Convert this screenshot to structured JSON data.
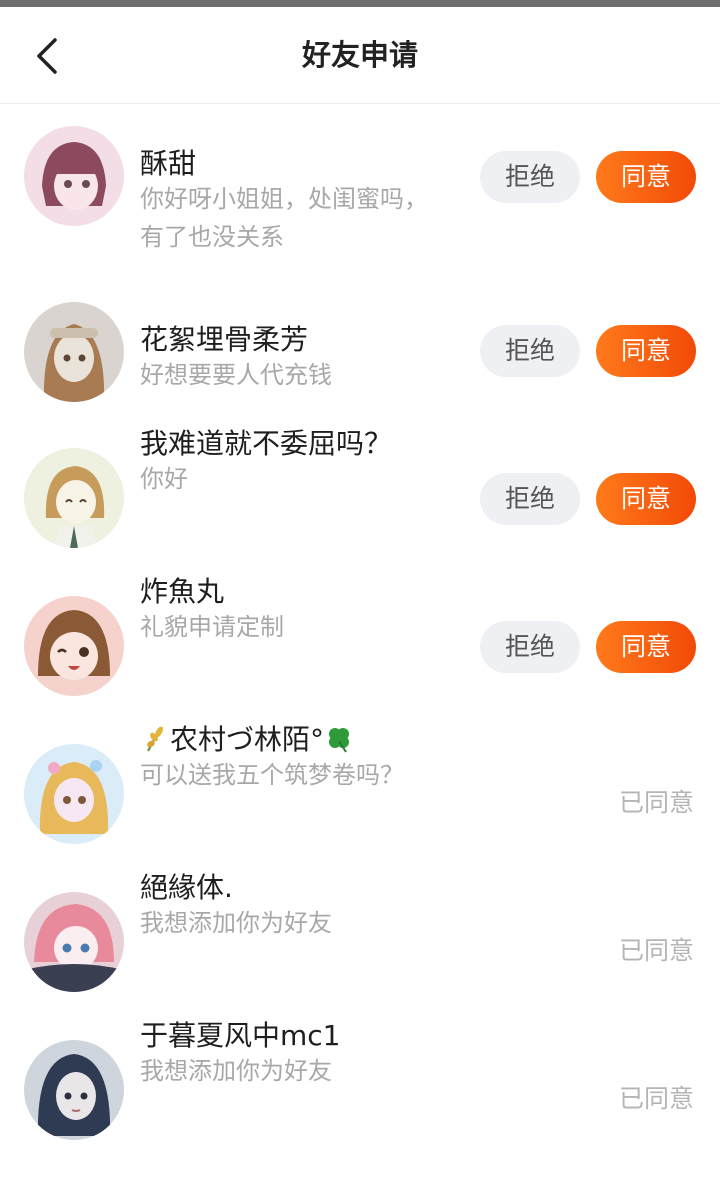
{
  "header": {
    "title": "好友申请",
    "back_icon": "chevron-left-icon"
  },
  "requests": [
    {
      "name": "酥甜",
      "message": "你好呀小姐姐，处闺蜜吗，有了也没关系",
      "state": "pending",
      "reject_label": "拒绝",
      "accept_label": "同意",
      "avatar_colors": [
        "#f3dde6",
        "#8b4a5e",
        "#f9e6ea"
      ]
    },
    {
      "name": "花絮埋骨柔芳",
      "message": "好想要要人代充钱",
      "state": "pending",
      "reject_label": "拒绝",
      "accept_label": "同意",
      "avatar_colors": [
        "#d9d4cf",
        "#a87b52",
        "#eae3da"
      ]
    },
    {
      "name": "我难道就不委屈吗？",
      "message": "你好",
      "state": "pending",
      "reject_label": "拒绝",
      "accept_label": "同意",
      "avatar_colors": [
        "#eef0e0",
        "#c79b5a",
        "#f7f3e6"
      ]
    },
    {
      "name": "炸魚丸",
      "message": "礼貌申请定制",
      "state": "pending",
      "reject_label": "拒绝",
      "accept_label": "同意",
      "avatar_colors": [
        "#f6d2cc",
        "#8a5a36",
        "#fbe6df"
      ]
    },
    {
      "name": "农村づ林陌°",
      "name_prefix_icon": "wheat-icon",
      "name_suffix_icon": "clover-icon",
      "message": "可以送我五个筑梦卷吗？",
      "state": "accepted",
      "status_label": "已同意",
      "avatar_colors": [
        "#d9ecf7",
        "#e8b95a",
        "#f6e7f2"
      ]
    },
    {
      "name": "絕緣体.",
      "message": "我想添加你为好友",
      "state": "accepted",
      "status_label": "已同意",
      "avatar_colors": [
        "#e7d0d6",
        "#e98a9c",
        "#3b3f52"
      ]
    },
    {
      "name": "于暮夏风中mc1",
      "message": "我想添加你为好友",
      "state": "accepted",
      "status_label": "已同意",
      "avatar_colors": [
        "#cfd5dc",
        "#2f3b52",
        "#e9e6e8"
      ]
    }
  ]
}
